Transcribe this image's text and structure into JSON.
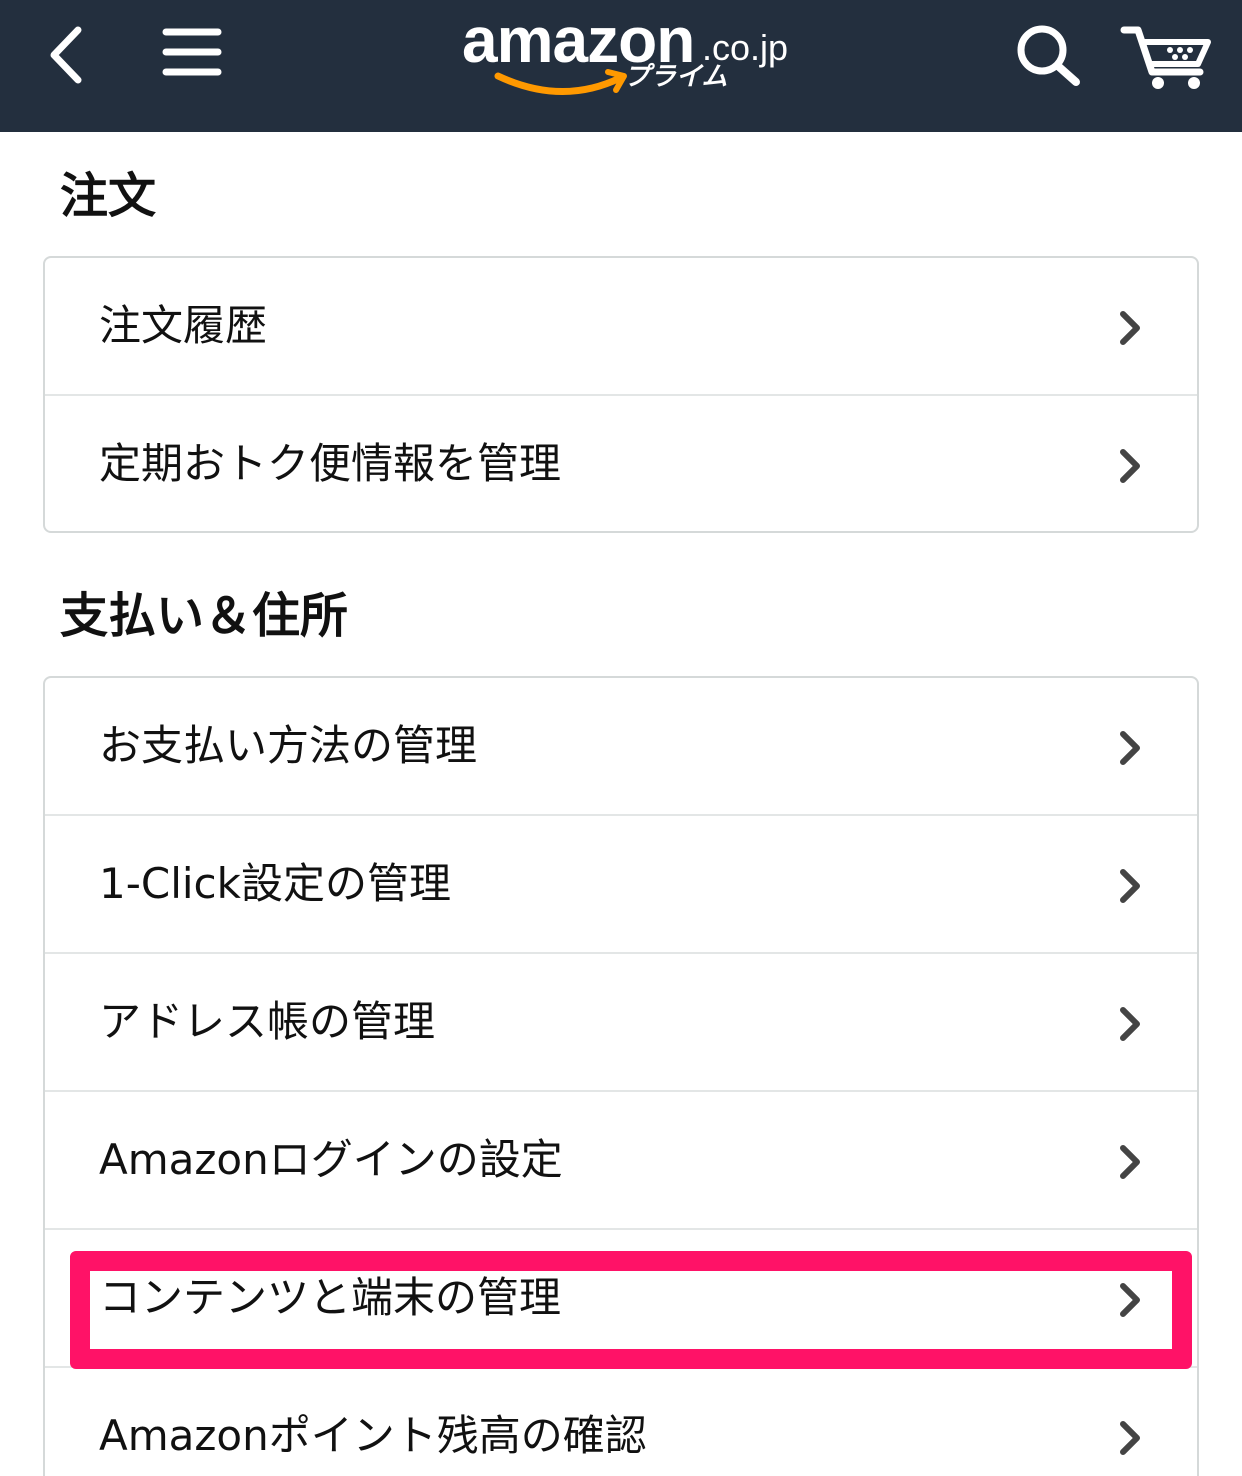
{
  "header": {
    "logo": {
      "wordmark": "amazon",
      "tld": ".co.jp",
      "subbrand": "プライム"
    },
    "icons": {
      "back": "back-chevron-icon",
      "menu": "hamburger-menu-icon",
      "search": "search-icon",
      "cart": "cart-icon"
    },
    "background_color": "#232f3e",
    "logo_smile_color": "#ff9900"
  },
  "sections": [
    {
      "title": "注文",
      "items": [
        {
          "label": "注文履歴"
        },
        {
          "label": "定期おトク便情報を管理"
        }
      ]
    },
    {
      "title": "支払い＆住所",
      "items": [
        {
          "label": "お支払い方法の管理"
        },
        {
          "label": "1-Click設定の管理"
        },
        {
          "label": "アドレス帳の管理"
        },
        {
          "label": "Amazonログインの設定"
        },
        {
          "label": "コンテンツと端末の管理",
          "highlighted": true
        },
        {
          "label": "Amazonポイント残高の確認"
        }
      ]
    }
  ],
  "highlight_color": "#ff1267"
}
